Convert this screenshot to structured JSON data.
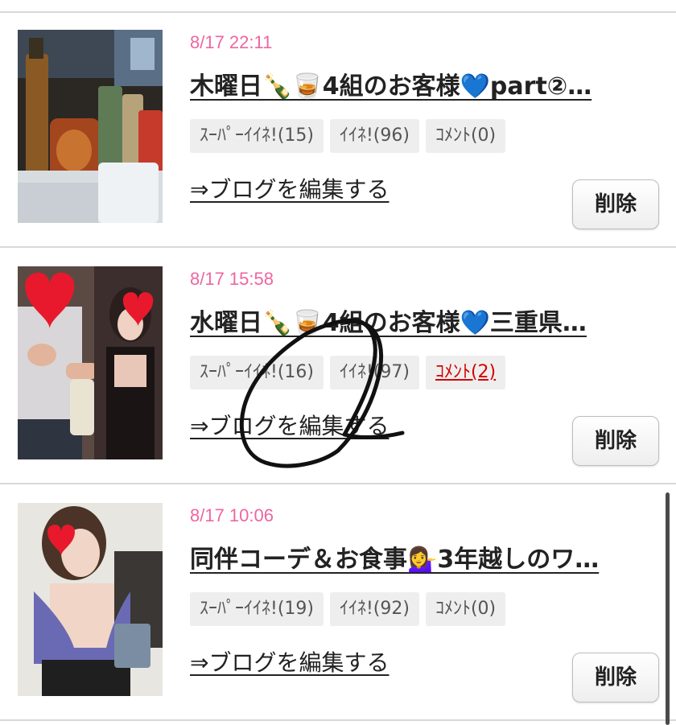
{
  "entries": [
    {
      "date": "8/17 22:11",
      "title": "木曜日🍾🥃4組のお客様💙part②…",
      "tags": {
        "super_like": "ｽｰﾊﾟｰｲｲﾈ!(15)",
        "like": "ｲｲﾈ!(96)",
        "comment": "ｺﾒﾝﾄ(0)"
      },
      "edit_link": "⇒ブログを編集する",
      "delete_label": "削除",
      "thumbnail_icon": "bar-bottles-photo"
    },
    {
      "date": "8/17 15:58",
      "title": "水曜日🍾🥃4組のお客様💙三重県…",
      "tags": {
        "super_like": "ｽｰﾊﾟｰｲｲﾈ!(16)",
        "like": "ｲｲﾈ!(97)",
        "comment": "ｺﾒﾝﾄ(2)"
      },
      "edit_link": "⇒ブログを編集する",
      "delete_label": "削除",
      "thumbnail_icon": "couple-with-hearts-photo"
    },
    {
      "date": "8/17 10:06",
      "title": "同伴コーデ＆お食事💁‍♀️3年越しのワ…",
      "tags": {
        "super_like": "ｽｰﾊﾟｰｲｲﾈ!(19)",
        "like": "ｲｲﾈ!(92)",
        "comment": "ｺﾒﾝﾄ(0)"
      },
      "edit_link": "⇒ブログを編集する",
      "delete_label": "削除",
      "thumbnail_icon": "woman-outfit-photo"
    }
  ],
  "colors": {
    "date": "#ee66a0",
    "comment_active": "#d60000",
    "heart": "#e8192c"
  }
}
